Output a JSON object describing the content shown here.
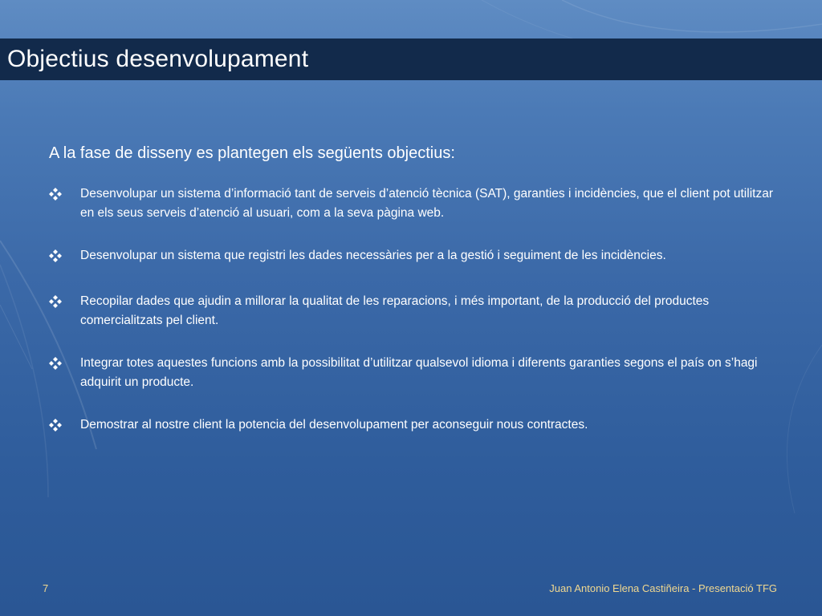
{
  "slide": {
    "title": "Objectius desenvolupament",
    "intro": "A la fase de disseny es plantegen els següents objectius:",
    "bullets": [
      "Desenvolupar un sistema d’informació tant de serveis d’atenció tècnica (SAT), garanties i incidències, que el client pot utilitzar en els seus serveis d’atenció al usuari, com a la seva pàgina web.",
      "Desenvolupar un sistema que registri les dades necessàries per a la gestió i seguiment de les incidències.",
      "Recopilar dades que ajudin a millorar la qualitat de les reparacions, i més important, de la producció  del productes comercialitzats pel client.",
      "Integrar totes aquestes funcions amb la possibilitat d’utilitzar qualsevol idioma i diferents garanties segons el país on s’hagi adquirit un producte.",
      "Demostrar al nostre client la potencia del desenvolupament per aconseguir nous contractes."
    ],
    "bullet_icon": "diamond-bullet-icon"
  },
  "footer": {
    "page_number": "7",
    "author": "Juan Antonio Elena Castiñeira - Presentació TFG"
  },
  "colors": {
    "title_bar": "#122a4b",
    "footer_text": "#f0d890"
  }
}
